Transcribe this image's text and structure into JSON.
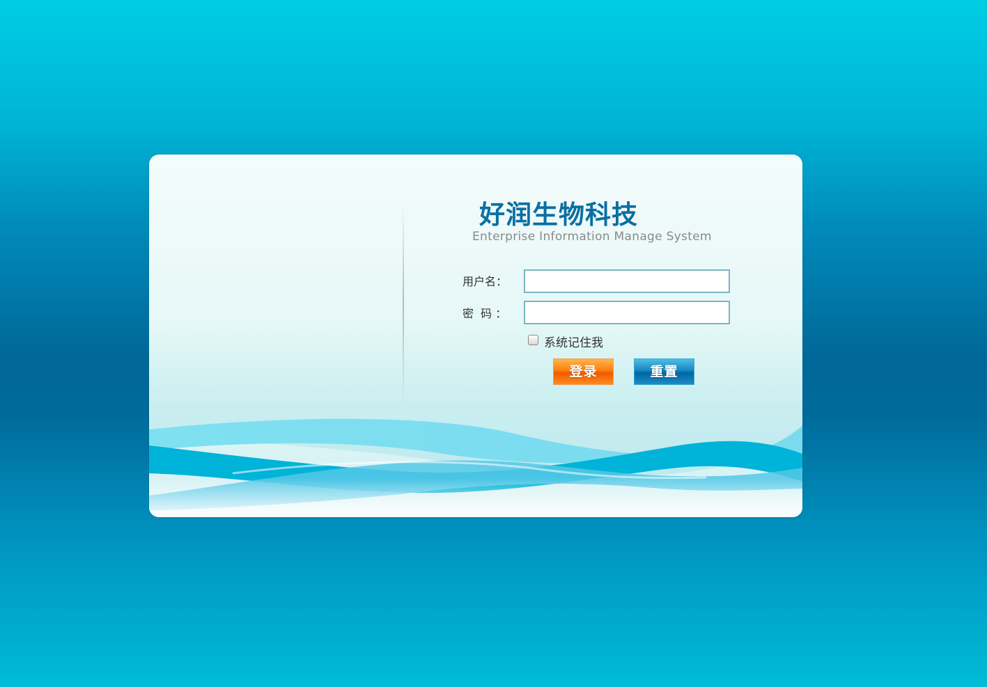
{
  "brand": {
    "title": "好润生物科技",
    "subtitle": "Enterprise Information Manage System"
  },
  "form": {
    "username_label": "用户名：",
    "password_label": "密  码 ：",
    "username_value": "",
    "password_value": "",
    "remember_label": "系统记住我",
    "remember_checked": false,
    "login_button": "登录",
    "reset_button": "重置"
  },
  "colors": {
    "background_top": "#00cde4",
    "background_middle": "#006898",
    "brand_title": "#0a6fa3",
    "login_button": "#ff7e0a",
    "reset_button": "#1786bf"
  }
}
